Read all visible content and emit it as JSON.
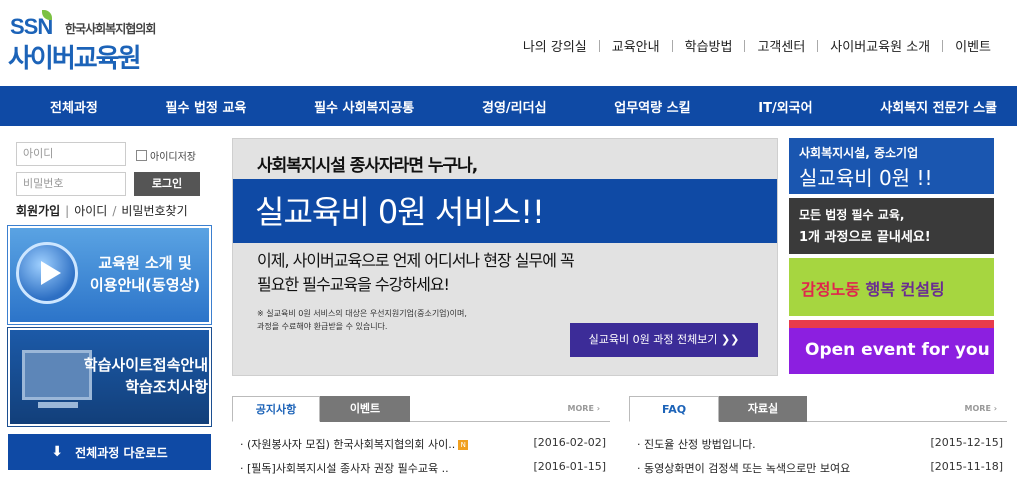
{
  "logo": {
    "ssn": "SSN",
    "org": "한국사회복지협의회",
    "cyber": "사이버교육원"
  },
  "topnav": [
    "나의 강의실",
    "교육안내",
    "학습방법",
    "고객센터",
    "사이버교육원 소개",
    "이벤트"
  ],
  "gnb": [
    "전체과정",
    "필수 법정 교육",
    "필수 사회복지공통",
    "경영/리더십",
    "업무역량 스킬",
    "IT/외국어",
    "사회복지 전문가 스쿨"
  ],
  "login": {
    "id_placeholder": "아이디",
    "pw_placeholder": "비밀번호",
    "save_id": "아이디저장",
    "button": "로그인",
    "join": "회원가입",
    "find_id": "아이디",
    "find_pw": "비밀번호찾기"
  },
  "left_banners": {
    "video": [
      "교육원 소개 및",
      "이용안내(동영상)"
    ],
    "guide": [
      "학습사이트접속안내",
      "학습조치사항"
    ],
    "download": "전체과정 다운로드"
  },
  "main_banner": {
    "head": "사회복지시설 종사자라면 누구나,",
    "title": "실교육비 0원 서비스!!",
    "body": [
      "이제, 사이버교육으로 언제 어디서나 현장 실무에 꼭",
      "필요한 필수교육을 수강하세요!"
    ],
    "note": [
      "※ 실교육비 0원 서비스의 대상은 우선지원기업(중소기업)이며,",
      "과정을 수료해야 환급받을 수 있습니다."
    ],
    "button": "실교육비 0원 과정 전체보기"
  },
  "right_banners": {
    "rb1": {
      "a": "사회복지시설, 중소기업",
      "b": "실교육비 0원 !!"
    },
    "rb2": {
      "a": "모든 법정 필수 교육,",
      "b": "1개 과정으로 끝내세요!"
    },
    "rb3": {
      "a": "감정노동",
      "b": "행복 컨설팅"
    },
    "rb4": "Open event for you"
  },
  "notice_board": {
    "tabs": [
      "공지사항",
      "이벤트"
    ],
    "more": "MORE",
    "rows": [
      {
        "title": "· (자원봉사자 모집) 한국사회복지협의회 사이..",
        "date": "[2016-02-02]",
        "new": "N"
      },
      {
        "title": "· [필독]사회복지시설 종사자 권장 필수교육 ..",
        "date": "[2016-01-15]"
      }
    ]
  },
  "faq_board": {
    "tabs": [
      "FAQ",
      "자료실"
    ],
    "more": "MORE",
    "rows": [
      {
        "title": "· 진도율 산정 방법입니다.",
        "date": "[2015-12-15]"
      },
      {
        "title": "· 동영상화면이 검정색 또는 녹색으로만 보여요",
        "date": "[2015-11-18]"
      }
    ]
  }
}
